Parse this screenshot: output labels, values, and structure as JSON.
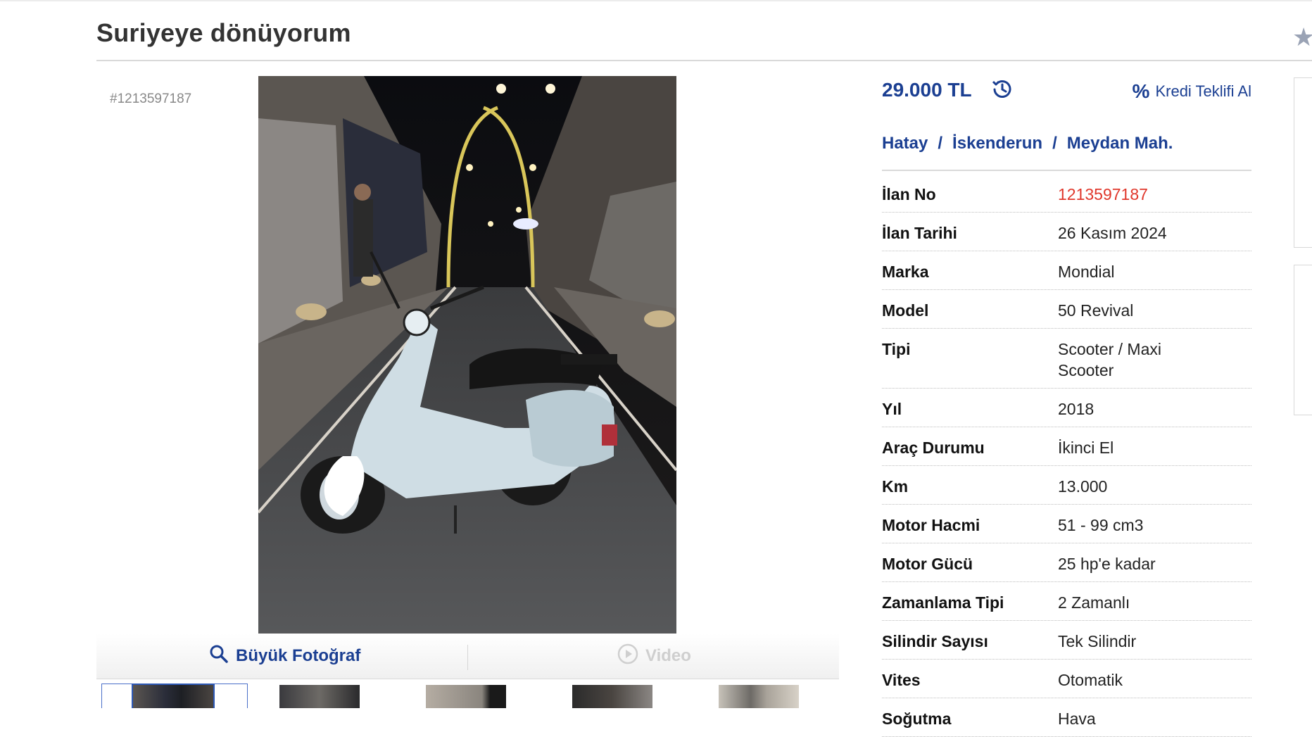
{
  "title": "Suriyeye dönüyorum",
  "listing_hash": "#1213597187",
  "price": "29.000 TL",
  "credit_label": "Kredi Teklifi Al",
  "location": {
    "city": "Hatay",
    "district": "İskenderun",
    "neighborhood": "Meydan Mah.",
    "separator": "/"
  },
  "photo_actions": {
    "big_photo": "Büyük Fotoğraf",
    "video": "Video"
  },
  "specs": [
    {
      "label": "İlan No",
      "value": "1213597187"
    },
    {
      "label": "İlan Tarihi",
      "value": "26 Kasım 2024"
    },
    {
      "label": "Marka",
      "value": "Mondial"
    },
    {
      "label": "Model",
      "value": "50 Revival"
    },
    {
      "label": "Tipi",
      "value": "Scooter / Maxi Scooter"
    },
    {
      "label": "Yıl",
      "value": "2018"
    },
    {
      "label": "Araç Durumu",
      "value": "İkinci El"
    },
    {
      "label": "Km",
      "value": "13.000"
    },
    {
      "label": "Motor Hacmi",
      "value": "51 - 99 cm3"
    },
    {
      "label": "Motor Gücü",
      "value": "25 hp'e kadar"
    },
    {
      "label": "Zamanlama Tipi",
      "value": "2 Zamanlı"
    },
    {
      "label": "Silindir Sayısı",
      "value": "Tek Silindir"
    },
    {
      "label": "Vites",
      "value": "Otomatik"
    },
    {
      "label": "Soğutma",
      "value": "Hava"
    }
  ],
  "colors": {
    "brand_blue": "#1b3f92",
    "listing_no_red": "#e0372b"
  }
}
